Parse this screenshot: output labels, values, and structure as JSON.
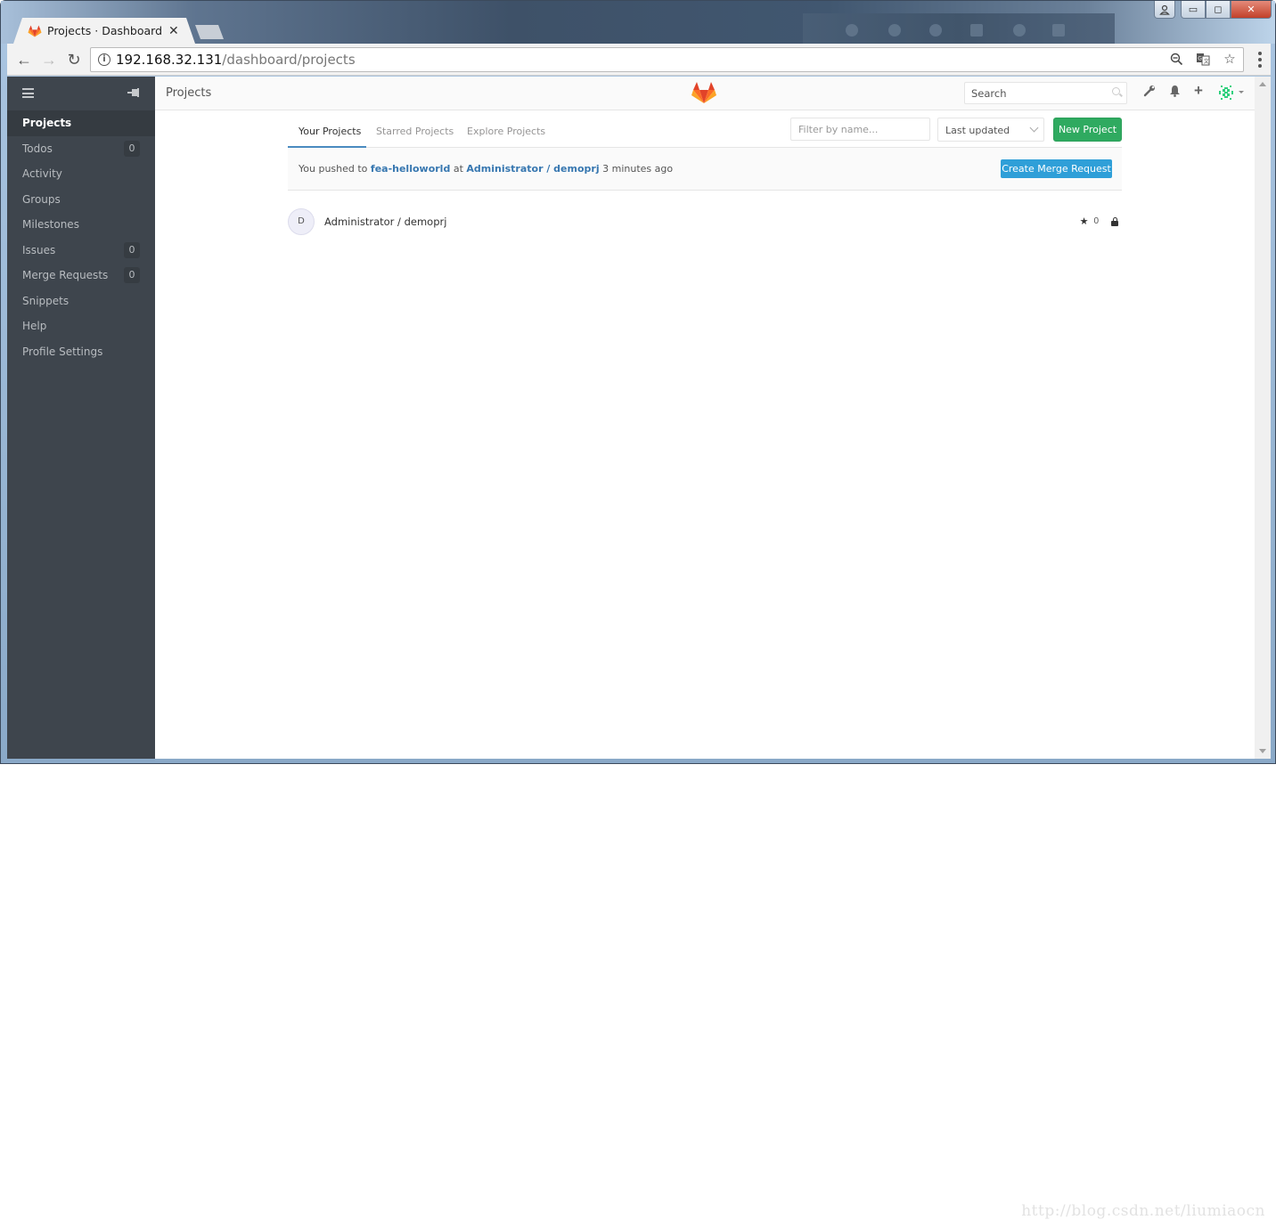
{
  "browser": {
    "tab_title": "Projects · Dashboard · GitLab",
    "tab_title_visible": "Projects · Dashboard · ",
    "url_host": "192.168.32.131",
    "url_path": "/dashboard/projects",
    "icons": [
      "back-icon",
      "forward-icon",
      "reload-icon",
      "info-icon",
      "zoom-out-icon",
      "translate-icon",
      "bookmark-star-icon",
      "menu-icon"
    ]
  },
  "window_controls": {
    "minimize": "▭",
    "maximize": "◻",
    "close": "✕"
  },
  "sidebar": {
    "items": [
      {
        "label": "Projects",
        "active": true
      },
      {
        "label": "Todos",
        "count": "0"
      },
      {
        "label": "Activity"
      },
      {
        "label": "Groups"
      },
      {
        "label": "Milestones"
      },
      {
        "label": "Issues",
        "count": "0"
      },
      {
        "label": "Merge Requests",
        "count": "0"
      },
      {
        "label": "Snippets"
      },
      {
        "label": "Help"
      },
      {
        "label": "Profile Settings"
      }
    ]
  },
  "header": {
    "title": "Projects",
    "search_placeholder": "Search"
  },
  "project_tabs": [
    {
      "label": "Your Projects",
      "active": true
    },
    {
      "label": "Starred Projects"
    },
    {
      "label": "Explore Projects"
    }
  ],
  "filters": {
    "filter_placeholder": "Filter by name...",
    "sort_value": "Last updated",
    "new_project_label": "New Project"
  },
  "push_event": {
    "prefix": "You pushed to",
    "branch": "fea-helloworld",
    "at": "at",
    "project": "Administrator / demoprj",
    "time": "3 minutes ago",
    "button_label": "Create Merge Request"
  },
  "projects": [
    {
      "avatar_letter": "D",
      "name": "Administrator / demoprj",
      "stars": "0",
      "visibility": "private"
    }
  ],
  "colors": {
    "sidebar_bg": "#3e454d",
    "new_project_green": "#2faa60",
    "merge_request_blue": "#2f9fd8",
    "link_blue": "#3777b0",
    "active_tab_underline": "#4a8bc0",
    "gitlab_orange": "#e24329"
  },
  "watermark": "http://blog.csdn.net/liumiaocn"
}
